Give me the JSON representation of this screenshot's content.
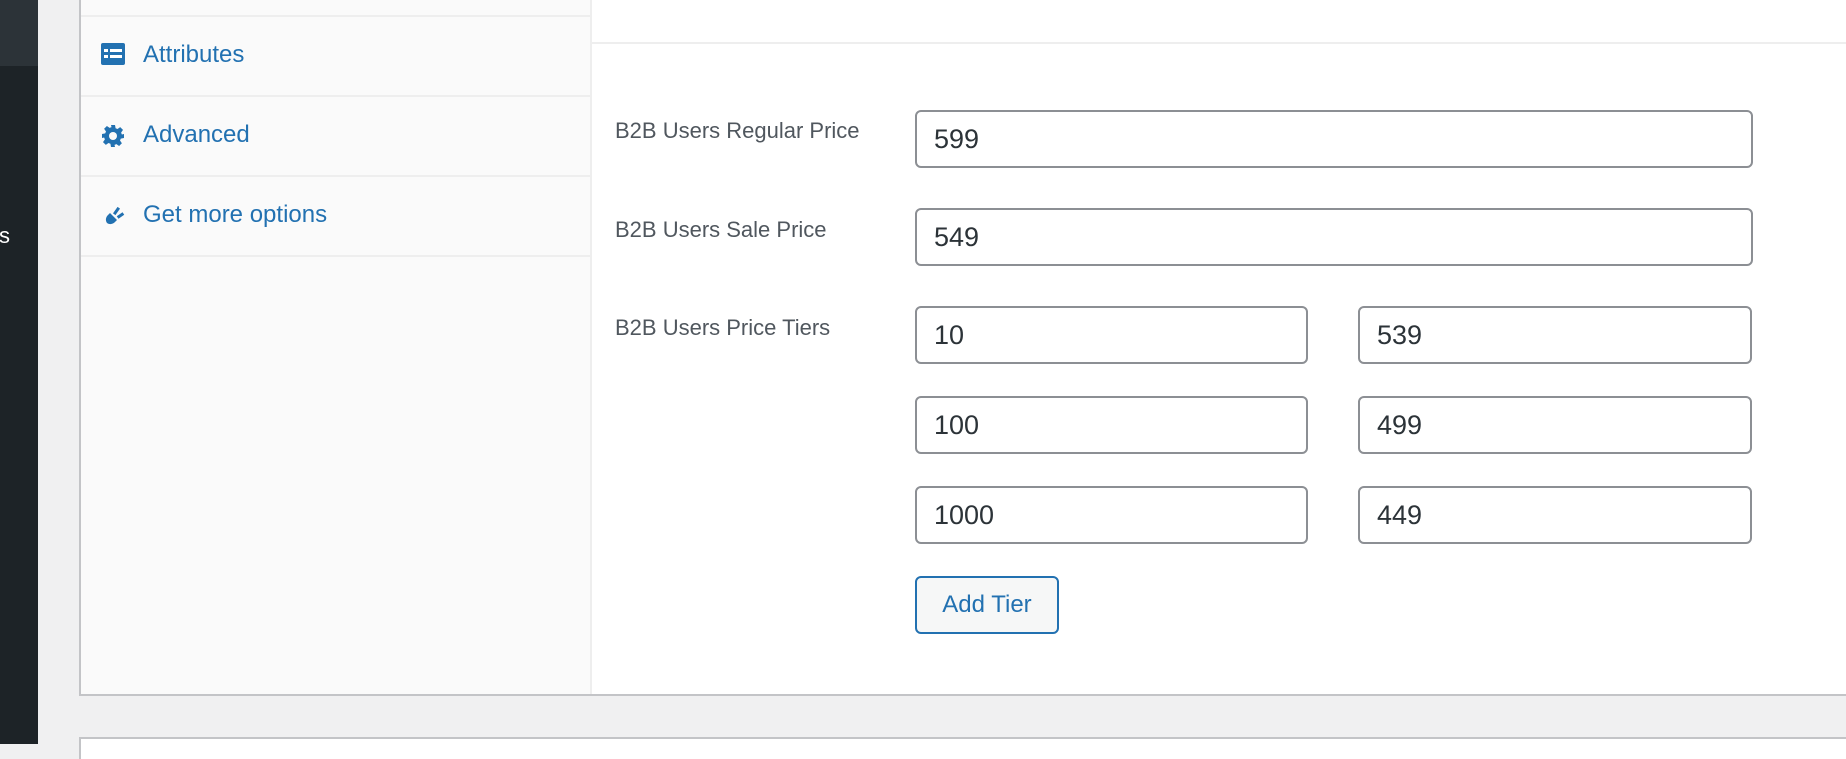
{
  "admin_sidebar": {
    "visible_menu_text": "s"
  },
  "product_data_tabs": [
    {
      "label": "Attributes",
      "icon": "attributes-list-icon"
    },
    {
      "label": "Advanced",
      "icon": "gear-icon"
    },
    {
      "label": "Get more options",
      "icon": "plug-icon"
    }
  ],
  "b2b_pricing": {
    "regular_price": {
      "label": "B2B Users Regular Price",
      "value": "599"
    },
    "sale_price": {
      "label": "B2B Users Sale Price",
      "value": "549"
    },
    "price_tiers": {
      "label": "B2B Users Price Tiers",
      "tiers": [
        {
          "quantity": "10",
          "price": "539"
        },
        {
          "quantity": "100",
          "price": "499"
        },
        {
          "quantity": "1000",
          "price": "449"
        }
      ],
      "add_button_label": "Add Tier"
    }
  },
  "colors": {
    "accent": "#2271b1",
    "admin_sidebar": "#1d2327",
    "input_border": "#8c8f94"
  }
}
